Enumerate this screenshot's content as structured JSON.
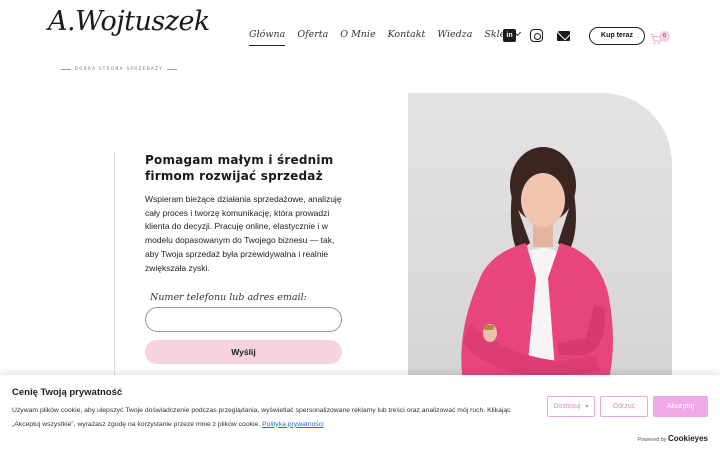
{
  "header": {
    "logo_text": "A.Wojtuszek",
    "logo_tagline": "DOBRA STRONA SPRZEDAŻY",
    "nav": [
      {
        "label": "Główna",
        "active": true
      },
      {
        "label": "Oferta",
        "active": false
      },
      {
        "label": "O Mnie",
        "active": false
      },
      {
        "label": "Kontakt",
        "active": false
      },
      {
        "label": "Wiedza",
        "active": false
      },
      {
        "label": "Sklep",
        "active": false,
        "dropdown": true
      }
    ],
    "social_icons": [
      "linkedin-icon",
      "instagram-icon",
      "mail-icon"
    ],
    "linkedin_glyph": "in",
    "buy_button": "Kup teraz",
    "cart_count": "0"
  },
  "hero": {
    "title": "Pomagam małym i średnim firmom rozwijać sprzedaż",
    "body": "Wspieram bieżące działania sprzedażowe, analizuję cały proces i tworzę komunikację, która prowadzi klienta do decyzji. Pracuję online, elastycznie i w modelu dopasowanym do Twojego biznesu — tak, aby Twoja sprzedaż była przewidywalna i realnie zwiększała zyski.",
    "form_label": "Numer telefonu lub adres email:",
    "input_value": "",
    "submit_label": "Wyślij"
  },
  "cookie_banner": {
    "title": "Cenię Twoją prywatność",
    "text": "Używam plików cookie, aby ulepszyć Twoje doświadczenie podczas przeglądania, wyświetlać spersonalizowane reklamy lub treści oraz analizować mój ruch. Klikając „Akceptuj wszystkie”, wyrażasz zgodę na korzystanie przeze mnie z plików cookie.",
    "policy_link": "Polityka prywatności",
    "customize_label": "Dostosuj",
    "reject_label": "Odrzuć",
    "accept_label": "Akceptuj",
    "powered_by": "Powered by",
    "brand": "Cookieyes"
  },
  "colors": {
    "accent_pink": "#f6d3df",
    "cookie_accent": "#f0a9e8",
    "jacket_pink": "#e8457e"
  }
}
